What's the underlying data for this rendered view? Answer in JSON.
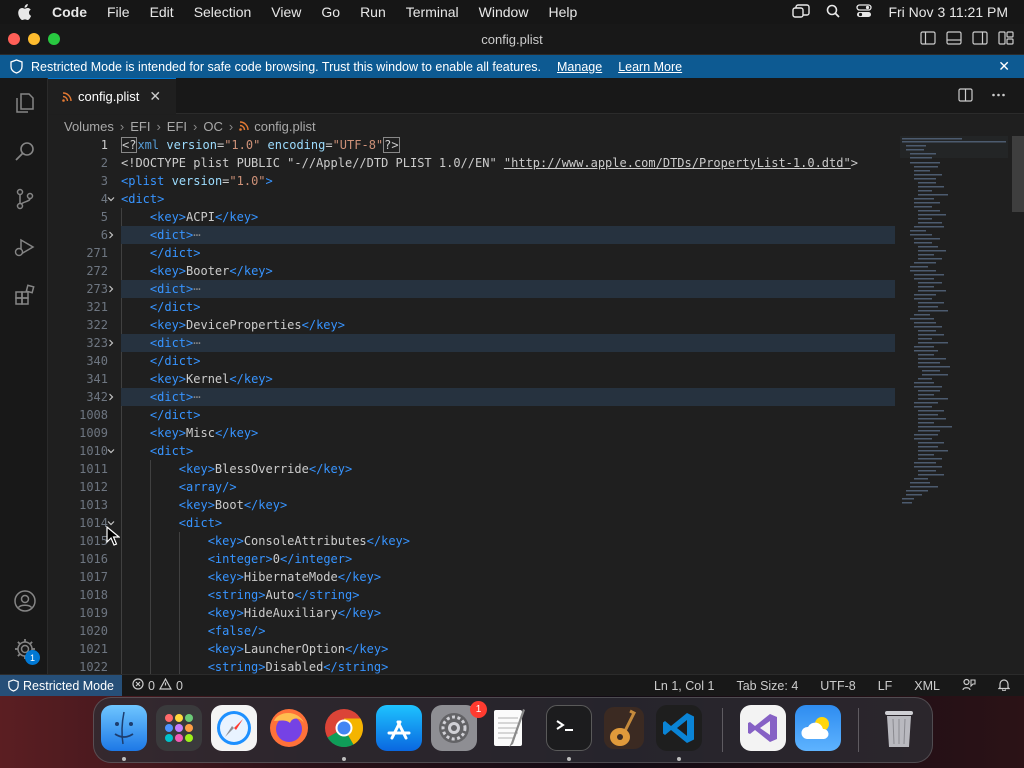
{
  "menubar": {
    "items": [
      "Code",
      "File",
      "Edit",
      "Selection",
      "View",
      "Go",
      "Run",
      "Terminal",
      "Window",
      "Help"
    ],
    "clock": "Fri Nov 3  11:21 PM"
  },
  "window": {
    "title": "config.plist"
  },
  "banner": {
    "message": "Restricted Mode is intended for safe code browsing. Trust this window to enable all features.",
    "manage": "Manage",
    "learn_more": "Learn More"
  },
  "tab": {
    "label": "config.plist"
  },
  "breadcrumb": [
    "Volumes",
    "EFI",
    "EFI",
    "OC",
    "config.plist"
  ],
  "editor": {
    "line_numbers": [
      "1",
      "2",
      "3",
      "4",
      "5",
      "6",
      "271",
      "272",
      "273",
      "321",
      "322",
      "323",
      "340",
      "341",
      "342",
      "1008",
      "1009",
      "1010",
      "1011",
      "1012",
      "1013",
      "1014",
      "1015",
      "1016",
      "1017",
      "1018",
      "1019",
      "1020",
      "1021",
      "1022"
    ],
    "xml_decl": {
      "pre": "<?",
      "name": "xml",
      "a1": "version",
      "v1": "\"1.0\"",
      "a2": "encoding",
      "v2": "\"UTF-8\"",
      "post": "?>"
    },
    "doctype": {
      "text": "<!DOCTYPE plist PUBLIC \"-//Apple//DTD PLIST 1.0//EN\" ",
      "url": "\"http://www.apple.com/DTDs/PropertyList-1.0.dtd\"",
      "end": ">"
    },
    "plist_open": {
      "open": "<plist",
      "attr": "version",
      "val": "\"1.0\"",
      "close": ">"
    },
    "keys": [
      "ACPI",
      "Booter",
      "DeviceProperties",
      "Kernel",
      "Misc",
      "BlessOverride",
      "Boot",
      "ConsoleAttributes",
      "HibernateMode",
      "HideAuxiliary",
      "LauncherOption"
    ],
    "integer_value": "0",
    "string_values": [
      "Auto",
      "Disabled"
    ],
    "fold_marker": "⋯"
  },
  "status": {
    "restricted": "Restricted Mode",
    "errors": "0",
    "warnings": "0",
    "position": "Ln 1, Col 1",
    "tab_size": "Tab Size: 4",
    "encoding": "UTF-8",
    "eol": "LF",
    "language": "XML"
  },
  "activity_badge": "1",
  "dock_badge": "1",
  "colors": {
    "accent": "#0078d4",
    "banner": "#0d5a92",
    "tag": "#3794ff",
    "string": "#ce9178",
    "attribute": "#9cdcfe"
  }
}
